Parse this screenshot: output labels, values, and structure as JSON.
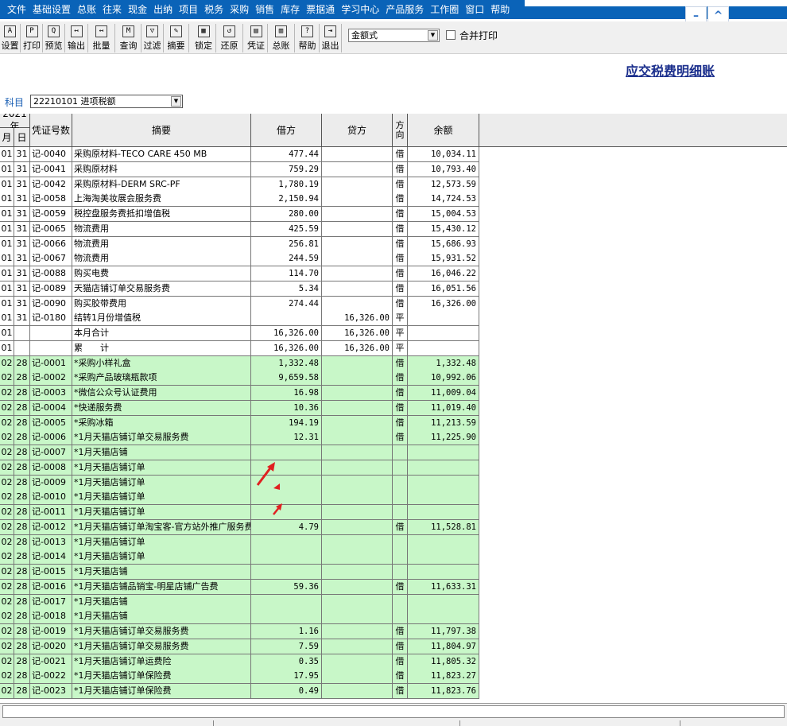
{
  "menu": [
    "文件",
    "基础设置",
    "总账",
    "往来",
    "现金",
    "出纳",
    "项目",
    "税务",
    "采购",
    "销售",
    "库存",
    "票据通",
    "学习中心",
    "产品服务",
    "工作圈",
    "窗口",
    "帮助"
  ],
  "window_controls": {
    "minimize": "–",
    "restore": "^"
  },
  "toolbar": [
    {
      "label": "设置",
      "icon": "A"
    },
    {
      "label": "打印",
      "icon": "P"
    },
    {
      "label": "预览",
      "icon": "Q"
    },
    {
      "label": "输出",
      "icon": "↤"
    },
    {
      "label": "批量",
      "icon": "↤"
    },
    {
      "label": "查询",
      "icon": "M"
    },
    {
      "label": "过滤",
      "icon": "▽"
    },
    {
      "label": "摘要",
      "icon": "✎"
    },
    {
      "label": "锁定",
      "icon": "▦"
    },
    {
      "label": "还原",
      "icon": "↺"
    },
    {
      "label": "凭证",
      "icon": "▤"
    },
    {
      "label": "总账",
      "icon": "▥"
    },
    {
      "label": "帮助",
      "icon": "?"
    },
    {
      "label": "退出",
      "icon": "⇥"
    }
  ],
  "format_select": {
    "value": "金额式"
  },
  "merge_print": {
    "label": "合并打印",
    "checked": false
  },
  "report_title": "应交税费明细账",
  "subject": {
    "label": "科目",
    "value": "22210101 进项税额"
  },
  "headers": {
    "year": "2021年",
    "month": "月",
    "day": "日",
    "voucher": "凭证号数",
    "summary": "摘要",
    "debit": "借方",
    "credit": "贷方",
    "direction": "方向",
    "balance": "余额"
  },
  "rows": [
    {
      "m": "01",
      "d": "31",
      "v": "记-0040",
      "s": "采购原材料-TECO CARE 450 MB",
      "dr": "477.44",
      "cr": "",
      "dir": "借",
      "bal": "10,034.11",
      "g": false
    },
    {
      "m": "01",
      "d": "31",
      "v": "记-0041",
      "s": "采购原材料",
      "dr": "759.29",
      "cr": "",
      "dir": "借",
      "bal": "10,793.40",
      "g": false
    },
    {
      "m": "01",
      "d": "31",
      "v": "记-0042",
      "s": "采购原材料-DERM SRC-PF",
      "dr": "1,780.19",
      "cr": "",
      "dir": "借",
      "bal": "12,573.59",
      "g": false
    },
    {
      "m": "01",
      "d": "31",
      "v": "记-0058",
      "s": "上海淘美妆展会服务费",
      "dr": "2,150.94",
      "cr": "",
      "dir": "借",
      "bal": "14,724.53",
      "g": false
    },
    {
      "m": "01",
      "d": "31",
      "v": "记-0059",
      "s": "税控盘服务费抵扣增值税",
      "dr": "280.00",
      "cr": "",
      "dir": "借",
      "bal": "15,004.53",
      "g": false
    },
    {
      "m": "01",
      "d": "31",
      "v": "记-0065",
      "s": "物流费用",
      "dr": "425.59",
      "cr": "",
      "dir": "借",
      "bal": "15,430.12",
      "g": false
    },
    {
      "m": "01",
      "d": "31",
      "v": "记-0066",
      "s": "物流费用",
      "dr": "256.81",
      "cr": "",
      "dir": "借",
      "bal": "15,686.93",
      "g": false
    },
    {
      "m": "01",
      "d": "31",
      "v": "记-0067",
      "s": "物流费用",
      "dr": "244.59",
      "cr": "",
      "dir": "借",
      "bal": "15,931.52",
      "g": false
    },
    {
      "m": "01",
      "d": "31",
      "v": "记-0088",
      "s": "购买电费",
      "dr": "114.70",
      "cr": "",
      "dir": "借",
      "bal": "16,046.22",
      "g": false
    },
    {
      "m": "01",
      "d": "31",
      "v": "记-0089",
      "s": "天猫店铺订单交易服务费",
      "dr": "5.34",
      "cr": "",
      "dir": "借",
      "bal": "16,051.56",
      "g": false
    },
    {
      "m": "01",
      "d": "31",
      "v": "记-0090",
      "s": "购买胶带费用",
      "dr": "274.44",
      "cr": "",
      "dir": "借",
      "bal": "16,326.00",
      "g": false
    },
    {
      "m": "01",
      "d": "31",
      "v": "记-0180",
      "s": "结转1月份增值税",
      "dr": "",
      "cr": "16,326.00",
      "dir": "平",
      "bal": "",
      "g": false
    },
    {
      "m": "01",
      "d": "",
      "v": "",
      "s": "本月合计",
      "dr": "16,326.00",
      "cr": "16,326.00",
      "dir": "平",
      "bal": "",
      "g": false
    },
    {
      "m": "01",
      "d": "",
      "v": "",
      "s": "累　　计",
      "dr": "16,326.00",
      "cr": "16,326.00",
      "dir": "平",
      "bal": "",
      "g": false
    },
    {
      "m": "02",
      "d": "28",
      "v": "记-0001",
      "s": "*采购小样礼盒",
      "dr": "1,332.48",
      "cr": "",
      "dir": "借",
      "bal": "1,332.48",
      "g": true
    },
    {
      "m": "02",
      "d": "28",
      "v": "记-0002",
      "s": "*采购产品玻璃瓶款项",
      "dr": "9,659.58",
      "cr": "",
      "dir": "借",
      "bal": "10,992.06",
      "g": true
    },
    {
      "m": "02",
      "d": "28",
      "v": "记-0003",
      "s": "*微信公众号认证费用",
      "dr": "16.98",
      "cr": "",
      "dir": "借",
      "bal": "11,009.04",
      "g": true
    },
    {
      "m": "02",
      "d": "28",
      "v": "记-0004",
      "s": "*快递服务费",
      "dr": "10.36",
      "cr": "",
      "dir": "借",
      "bal": "11,019.40",
      "g": true
    },
    {
      "m": "02",
      "d": "28",
      "v": "记-0005",
      "s": "*采购冰箱",
      "dr": "194.19",
      "cr": "",
      "dir": "借",
      "bal": "11,213.59",
      "g": true
    },
    {
      "m": "02",
      "d": "28",
      "v": "记-0006",
      "s": "*1月天猫店铺订单交易服务费",
      "dr": "12.31",
      "cr": "",
      "dir": "借",
      "bal": "11,225.90",
      "g": true
    },
    {
      "m": "02",
      "d": "28",
      "v": "记-0007",
      "s": "*1月天猫店铺",
      "dr": "",
      "cr": "",
      "dir": "",
      "bal": "",
      "g": true
    },
    {
      "m": "02",
      "d": "28",
      "v": "记-0008",
      "s": "*1月天猫店铺订单",
      "dr": "",
      "cr": "",
      "dir": "",
      "bal": "",
      "g": true
    },
    {
      "m": "02",
      "d": "28",
      "v": "记-0009",
      "s": "*1月天猫店铺订单",
      "dr": "",
      "cr": "",
      "dir": "",
      "bal": "",
      "g": true
    },
    {
      "m": "02",
      "d": "28",
      "v": "记-0010",
      "s": "*1月天猫店铺订单",
      "dr": "",
      "cr": "",
      "dir": "",
      "bal": "",
      "g": true
    },
    {
      "m": "02",
      "d": "28",
      "v": "记-0011",
      "s": "*1月天猫店铺订单",
      "dr": "",
      "cr": "",
      "dir": "",
      "bal": "",
      "g": true
    },
    {
      "m": "02",
      "d": "28",
      "v": "记-0012",
      "s": "*1月天猫店铺订单淘宝客-官方站外推广服务费",
      "dr": "4.79",
      "cr": "",
      "dir": "借",
      "bal": "11,528.81",
      "g": true
    },
    {
      "m": "02",
      "d": "28",
      "v": "记-0013",
      "s": "*1月天猫店铺订单",
      "dr": "",
      "cr": "",
      "dir": "",
      "bal": "",
      "g": true
    },
    {
      "m": "02",
      "d": "28",
      "v": "记-0014",
      "s": "*1月天猫店铺订单",
      "dr": "",
      "cr": "",
      "dir": "",
      "bal": "",
      "g": true
    },
    {
      "m": "02",
      "d": "28",
      "v": "记-0015",
      "s": "*1月天猫店铺",
      "dr": "",
      "cr": "",
      "dir": "",
      "bal": "",
      "g": true
    },
    {
      "m": "02",
      "d": "28",
      "v": "记-0016",
      "s": "*1月天猫店铺品销宝-明星店铺广告费",
      "dr": "59.36",
      "cr": "",
      "dir": "借",
      "bal": "11,633.31",
      "g": true
    },
    {
      "m": "02",
      "d": "28",
      "v": "记-0017",
      "s": "*1月天猫店铺",
      "dr": "",
      "cr": "",
      "dir": "",
      "bal": "",
      "g": true
    },
    {
      "m": "02",
      "d": "28",
      "v": "记-0018",
      "s": "*1月天猫店铺",
      "dr": "",
      "cr": "",
      "dir": "",
      "bal": "",
      "g": true
    },
    {
      "m": "02",
      "d": "28",
      "v": "记-0019",
      "s": "*1月天猫店铺订单交易服务费",
      "dr": "1.16",
      "cr": "",
      "dir": "借",
      "bal": "11,797.38",
      "g": true
    },
    {
      "m": "02",
      "d": "28",
      "v": "记-0020",
      "s": "*1月天猫店铺订单交易服务费",
      "dr": "7.59",
      "cr": "",
      "dir": "借",
      "bal": "11,804.97",
      "g": true
    },
    {
      "m": "02",
      "d": "28",
      "v": "记-0021",
      "s": "*1月天猫店铺订单运费险",
      "dr": "0.35",
      "cr": "",
      "dir": "借",
      "bal": "11,805.32",
      "g": true
    },
    {
      "m": "02",
      "d": "28",
      "v": "记-0022",
      "s": "*1月天猫店铺订单保险费",
      "dr": "17.95",
      "cr": "",
      "dir": "借",
      "bal": "11,823.27",
      "g": true
    },
    {
      "m": "02",
      "d": "28",
      "v": "记-0023",
      "s": "*1月天猫店铺订单保险费",
      "dr": "0.49",
      "cr": "",
      "dir": "借",
      "bal": "11,823.76",
      "g": true
    }
  ],
  "colors": {
    "menubar": "#0a63b8",
    "row_green": "#c8f7c8",
    "arrow": "#e02020",
    "title": "#1a2e8c"
  }
}
